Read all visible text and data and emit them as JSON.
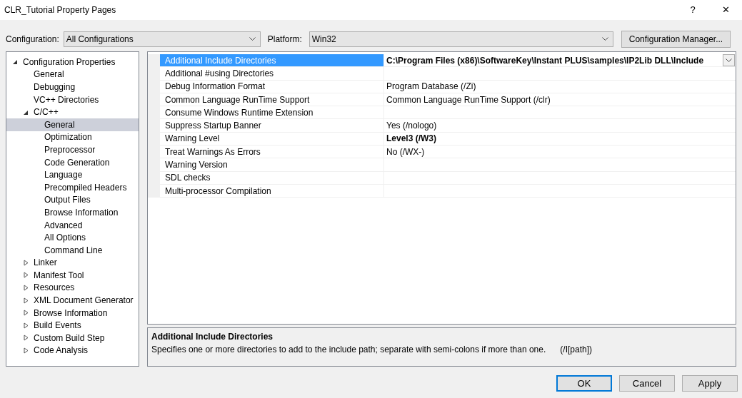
{
  "window": {
    "title": "CLR_Tutorial Property Pages",
    "help": "?",
    "close": "✕"
  },
  "toolbar": {
    "configuration_label": "Configuration:",
    "configuration_value": "All Configurations",
    "platform_label": "Platform:",
    "platform_value": "Win32",
    "manager_button": "Configuration Manager..."
  },
  "tree": [
    {
      "label": "Configuration Properties",
      "expanded": true,
      "selected": false,
      "children": [
        {
          "label": "General",
          "selected": false
        },
        {
          "label": "Debugging",
          "selected": false
        },
        {
          "label": "VC++ Directories",
          "selected": false
        },
        {
          "label": "C/C++",
          "expanded": true,
          "selected": false,
          "children": [
            {
              "label": "General",
              "selected": true
            },
            {
              "label": "Optimization",
              "selected": false
            },
            {
              "label": "Preprocessor",
              "selected": false
            },
            {
              "label": "Code Generation",
              "selected": false
            },
            {
              "label": "Language",
              "selected": false
            },
            {
              "label": "Precompiled Headers",
              "selected": false
            },
            {
              "label": "Output Files",
              "selected": false
            },
            {
              "label": "Browse Information",
              "selected": false
            },
            {
              "label": "Advanced",
              "selected": false
            },
            {
              "label": "All Options",
              "selected": false
            },
            {
              "label": "Command Line",
              "selected": false
            }
          ]
        },
        {
          "label": "Linker",
          "expanded": false,
          "selected": false
        },
        {
          "label": "Manifest Tool",
          "expanded": false,
          "selected": false
        },
        {
          "label": "Resources",
          "expanded": false,
          "selected": false
        },
        {
          "label": "XML Document Generator",
          "expanded": false,
          "selected": false
        },
        {
          "label": "Browse Information",
          "expanded": false,
          "selected": false
        },
        {
          "label": "Build Events",
          "expanded": false,
          "selected": false
        },
        {
          "label": "Custom Build Step",
          "expanded": false,
          "selected": false
        },
        {
          "label": "Code Analysis",
          "expanded": false,
          "selected": false
        }
      ]
    }
  ],
  "properties": [
    {
      "name": "Additional Include Directories",
      "value": "C:\\Program Files (x86)\\SoftwareKey\\Instant PLUS\\samples\\IP2Lib DLL\\Include",
      "modified": true,
      "selected": true
    },
    {
      "name": "Additional #using Directories",
      "modified": false,
      "selected": false
    },
    {
      "name": "Debug Information Format",
      "value": "Program Database (/Zi)",
      "modified": false,
      "selected": false
    },
    {
      "name": "Common Language RunTime Support",
      "value": "Common Language RunTime Support (/clr)",
      "modified": false,
      "selected": false
    },
    {
      "name": "Consume Windows Runtime Extension",
      "modified": false,
      "selected": false
    },
    {
      "name": "Suppress Startup Banner",
      "value": "Yes (/nologo)",
      "modified": false,
      "selected": false
    },
    {
      "name": "Warning Level",
      "value": "Level3 (/W3)",
      "modified": true,
      "selected": false
    },
    {
      "name": "Treat Warnings As Errors",
      "value": "No (/WX-)",
      "modified": false,
      "selected": false
    },
    {
      "name": "Warning Version",
      "modified": false,
      "selected": false
    },
    {
      "name": "SDL checks",
      "modified": false,
      "selected": false
    },
    {
      "name": "Multi-processor Compilation",
      "modified": false,
      "selected": false
    }
  ],
  "description": {
    "title": "Additional Include Directories",
    "text": "Specifies one or more directories to add to the include path; separate with semi-colons if more than one.",
    "switch": "(/I[path])"
  },
  "buttons": [
    {
      "label": "OK",
      "default": true
    },
    {
      "label": "Cancel",
      "default": false
    },
    {
      "label": "Apply",
      "default": false
    }
  ]
}
